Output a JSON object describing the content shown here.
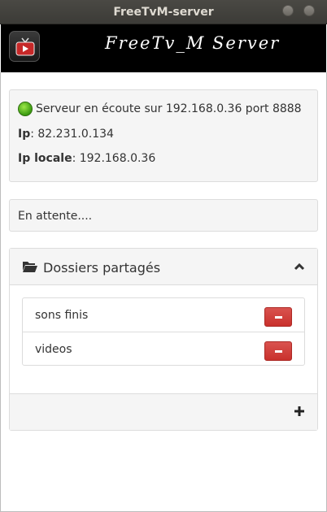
{
  "window": {
    "title": "FreeTvM-server"
  },
  "banner": {
    "title": "FreeTv_M Server",
    "logo_text": "FreeTv_M"
  },
  "info": {
    "status_text": "Serveur en écoute sur 192.168.0.36 port 8888",
    "ip_label": "Ip",
    "ip_value": ": 82.231.0.134",
    "local_ip_label": "Ip locale",
    "local_ip_value": ": 192.168.0.36",
    "status_color": "#4caf20"
  },
  "waiting": {
    "text": "En attente...."
  },
  "shares": {
    "title": "Dossiers partagés",
    "items": [
      {
        "name": "sons finis"
      },
      {
        "name": "videos"
      }
    ],
    "delete_color": "#d9534f"
  }
}
